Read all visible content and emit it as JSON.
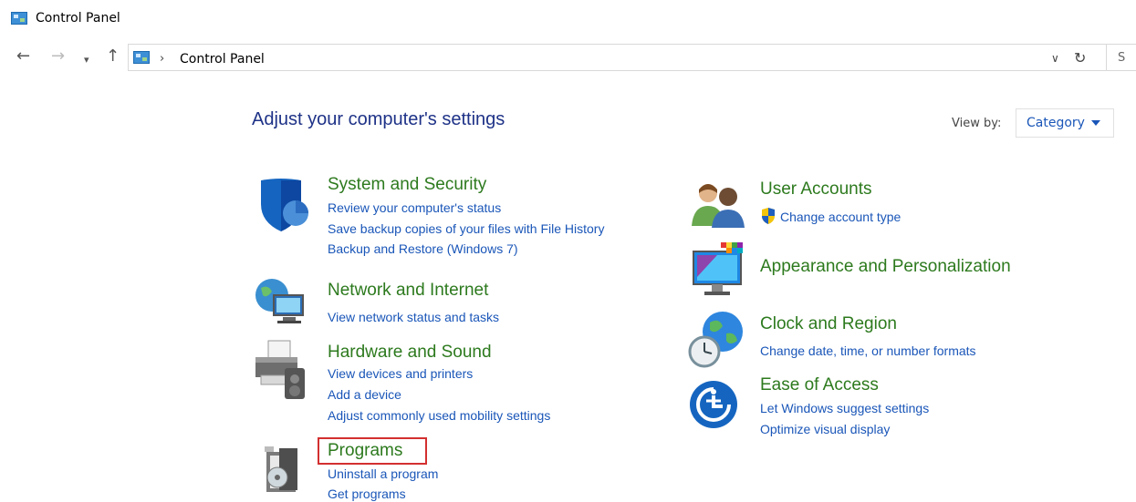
{
  "window": {
    "title": "Control Panel"
  },
  "address": {
    "path": "Control Panel",
    "search_stub": "S"
  },
  "main": {
    "heading": "Adjust your computer's settings",
    "view_by_label": "View by:",
    "view_by_value": "Category"
  },
  "categories": {
    "system": {
      "title": "System and Security",
      "links": [
        "Review your computer's status",
        "Save backup copies of your files with File History",
        "Backup and Restore (Windows 7)"
      ]
    },
    "network": {
      "title": "Network and Internet",
      "links": [
        "View network status and tasks"
      ]
    },
    "hardware": {
      "title": "Hardware and Sound",
      "links": [
        "View devices and printers",
        "Add a device",
        "Adjust commonly used mobility settings"
      ]
    },
    "programs": {
      "title": "Programs",
      "links": [
        "Uninstall a program",
        "Get programs"
      ]
    },
    "users": {
      "title": "User Accounts",
      "links": [
        "Change account type"
      ]
    },
    "appearance": {
      "title": "Appearance and Personalization",
      "links": []
    },
    "clock": {
      "title": "Clock and Region",
      "links": [
        "Change date, time, or number formats"
      ]
    },
    "ease": {
      "title": "Ease of Access",
      "links": [
        "Let Windows suggest settings",
        "Optimize visual display"
      ]
    }
  },
  "icons": {
    "app": "control-panel-icon",
    "system": "shield-icon",
    "network": "globe-network-icon",
    "hardware": "printer-speaker-icon",
    "programs": "programs-box-icon",
    "users": "users-icon",
    "appearance": "monitor-palette-icon",
    "clock": "clock-globe-icon",
    "ease": "ease-of-access-icon"
  },
  "colors": {
    "title_green": "#2d7a1e",
    "link_blue": "#1a56b8",
    "heading_blue": "#1e3287",
    "highlight_red": "#d32f2f"
  }
}
